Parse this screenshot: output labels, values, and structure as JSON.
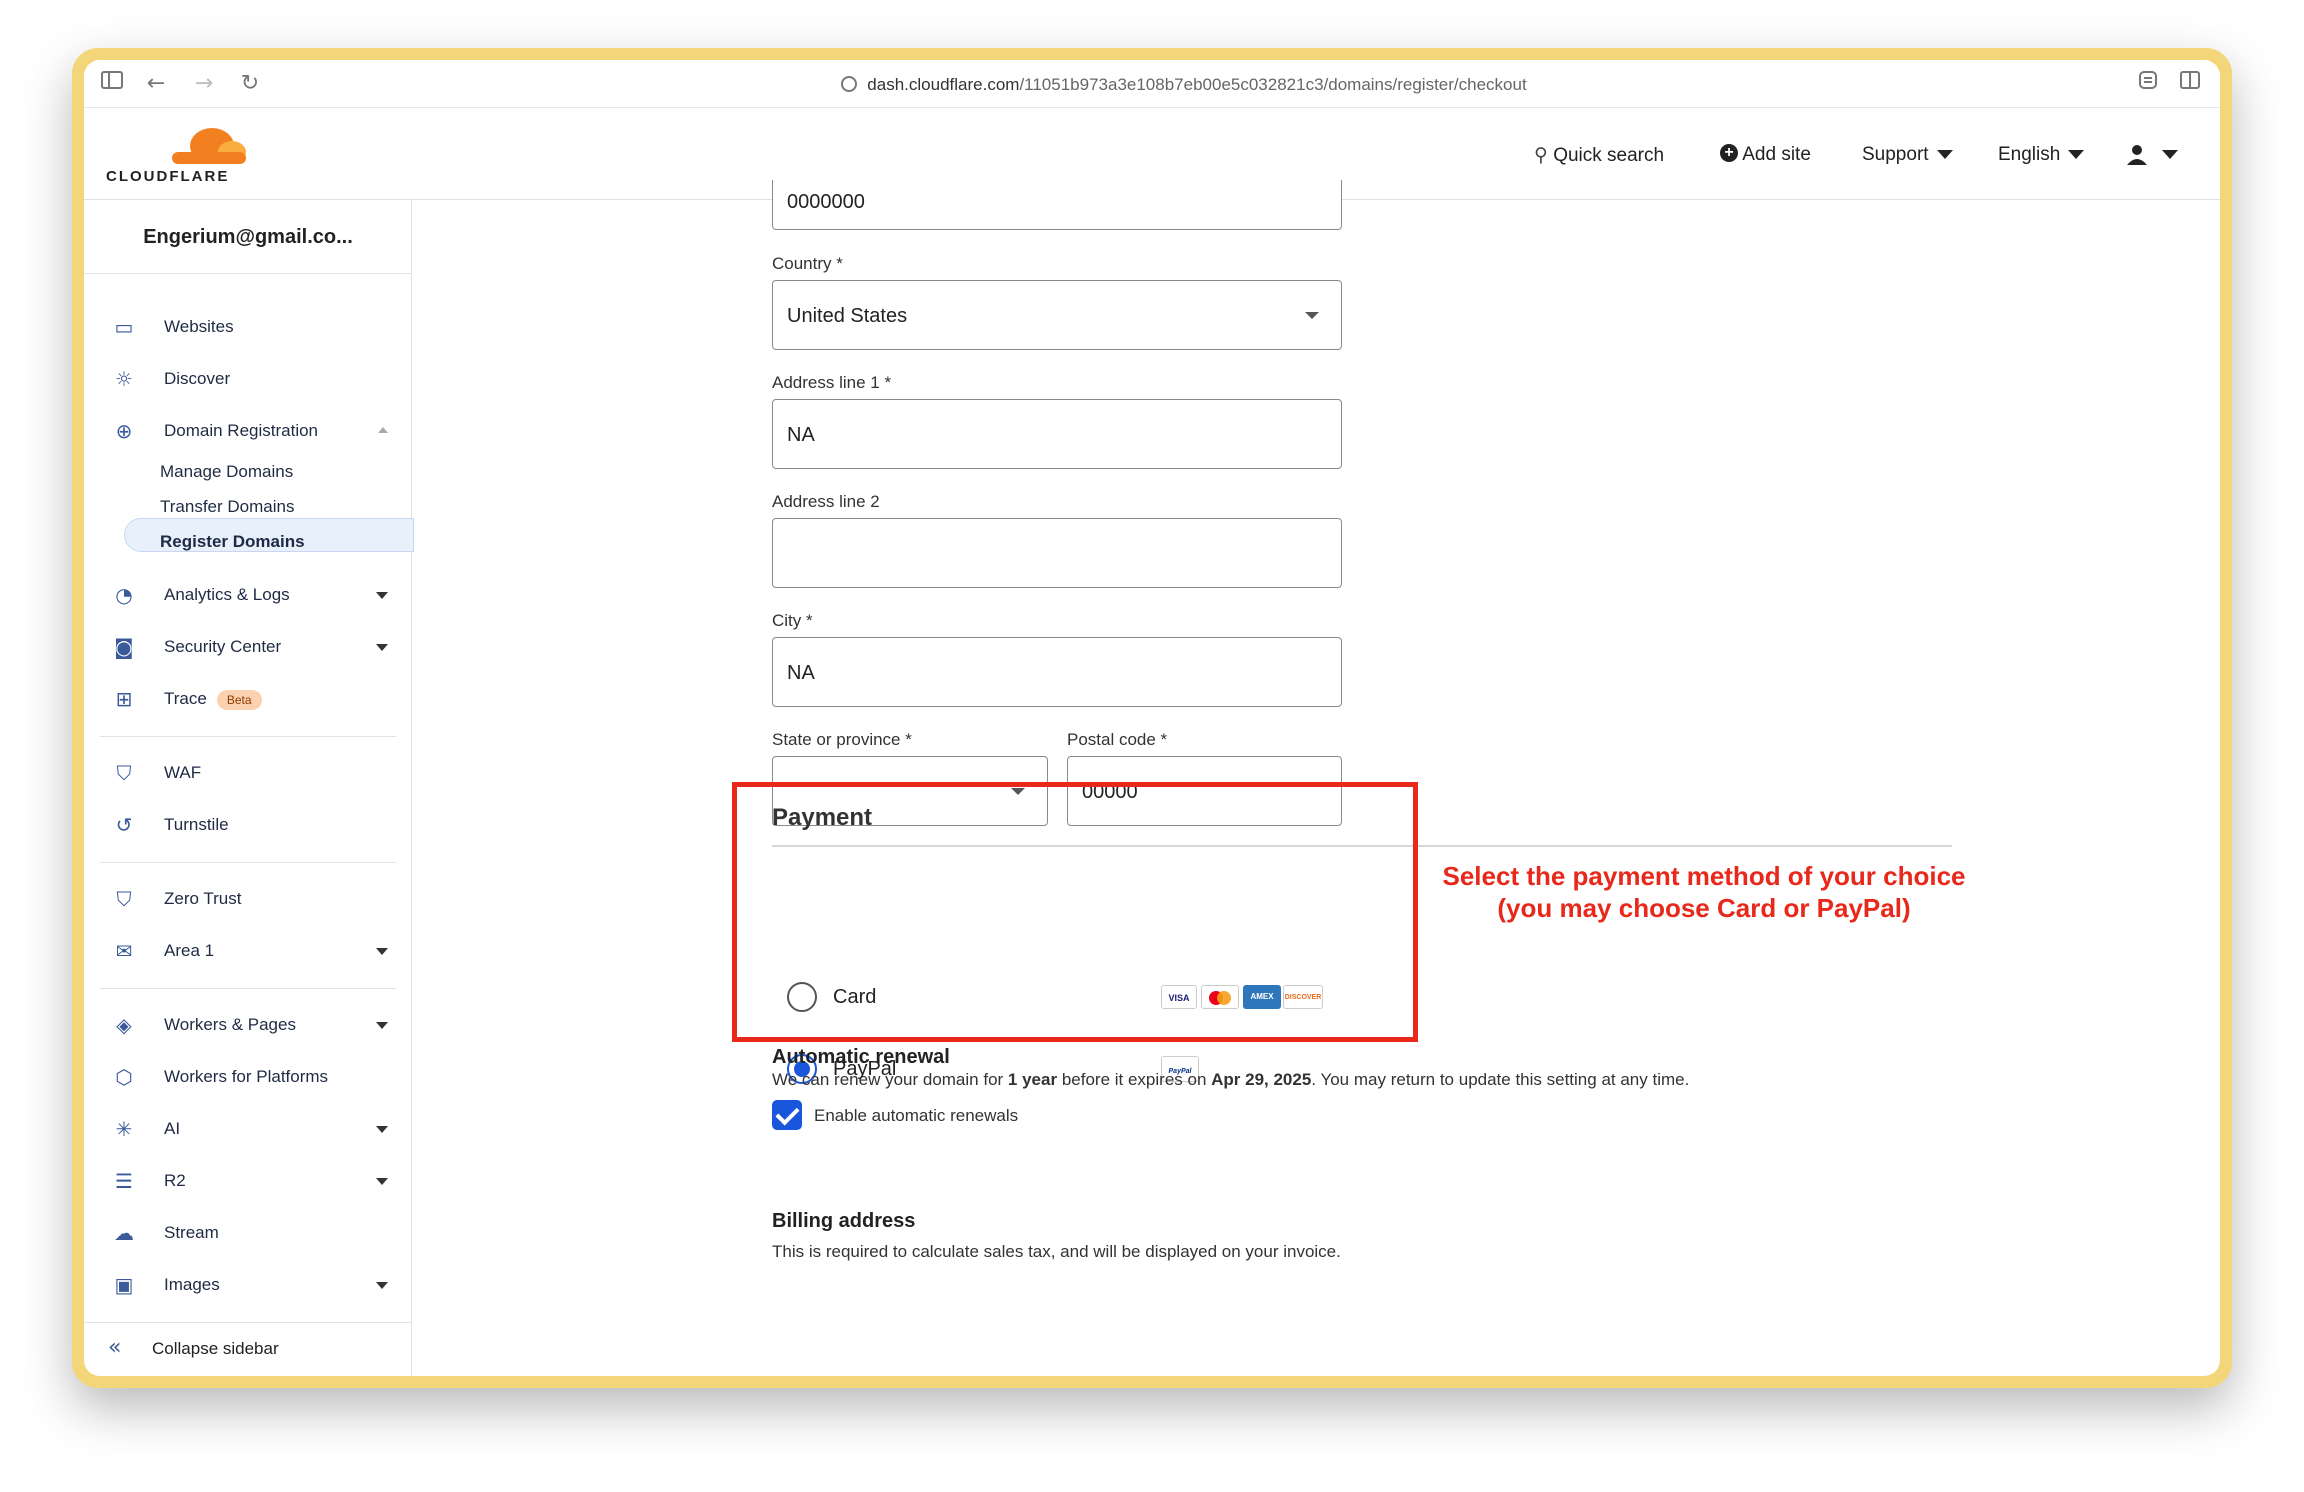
{
  "browser": {
    "url_host": "dash.cloudflare.com",
    "url_path": "/11051b973a3e108b7eb00e5c032821c3/domains/register/checkout"
  },
  "header": {
    "logo_text": "CLOUDFLARE",
    "quick_search": "Quick search",
    "add_site": "Add site",
    "support": "Support",
    "language": "English"
  },
  "sidebar": {
    "account": "Engerium@gmail.co...",
    "items": {
      "websites": "Websites",
      "discover": "Discover",
      "domain_registration": "Domain Registration",
      "manage_domains": "Manage Domains",
      "transfer_domains": "Transfer Domains",
      "register_domains": "Register Domains",
      "analytics": "Analytics & Logs",
      "security_center": "Security Center",
      "trace": "Trace",
      "trace_badge": "Beta",
      "waf": "WAF",
      "turnstile": "Turnstile",
      "zero_trust": "Zero Trust",
      "area1": "Area 1",
      "workers_pages": "Workers & Pages",
      "workers_platforms": "Workers for Platforms",
      "ai": "AI",
      "r2": "R2",
      "stream": "Stream",
      "images": "Images"
    },
    "collapse": "Collapse sidebar"
  },
  "form": {
    "phone_value": "0000000",
    "country_label": "Country *",
    "country_value": "United States",
    "address1_label": "Address line 1 *",
    "address1_value": "NA",
    "address2_label": "Address line 2",
    "address2_value": "",
    "city_label": "City *",
    "city_value": "NA",
    "state_label": "State or province *",
    "state_value": "",
    "postal_label": "Postal code *",
    "postal_value": "00000"
  },
  "payment": {
    "title": "Payment",
    "card_label": "Card",
    "paypal_label": "PayPal",
    "selected": "PayPal",
    "card_brands": [
      "VISA",
      "MC",
      "AMEX",
      "DISCOVER"
    ],
    "paypal_logo_text": "PayPal"
  },
  "annotation": {
    "line1": "Select the payment method of your choice",
    "line2": "(you may choose Card or PayPal)",
    "color": "#e8281a"
  },
  "renewal": {
    "title": "Automatic renewal",
    "text_pre": "We can renew your domain for ",
    "text_bold1": "1 year",
    "text_mid": " before it expires on ",
    "text_bold2": "Apr 29, 2025",
    "text_post": ". You may return to update this setting at any time.",
    "checkbox_label": "Enable automatic renewals",
    "checked": true
  },
  "billing": {
    "title": "Billing address",
    "text": "This is required to calculate sales tax, and will be displayed on your invoice."
  },
  "colors": {
    "accent": "#1a56db",
    "frame": "#f3d57a",
    "cloudflare_orange": "#f38020"
  }
}
